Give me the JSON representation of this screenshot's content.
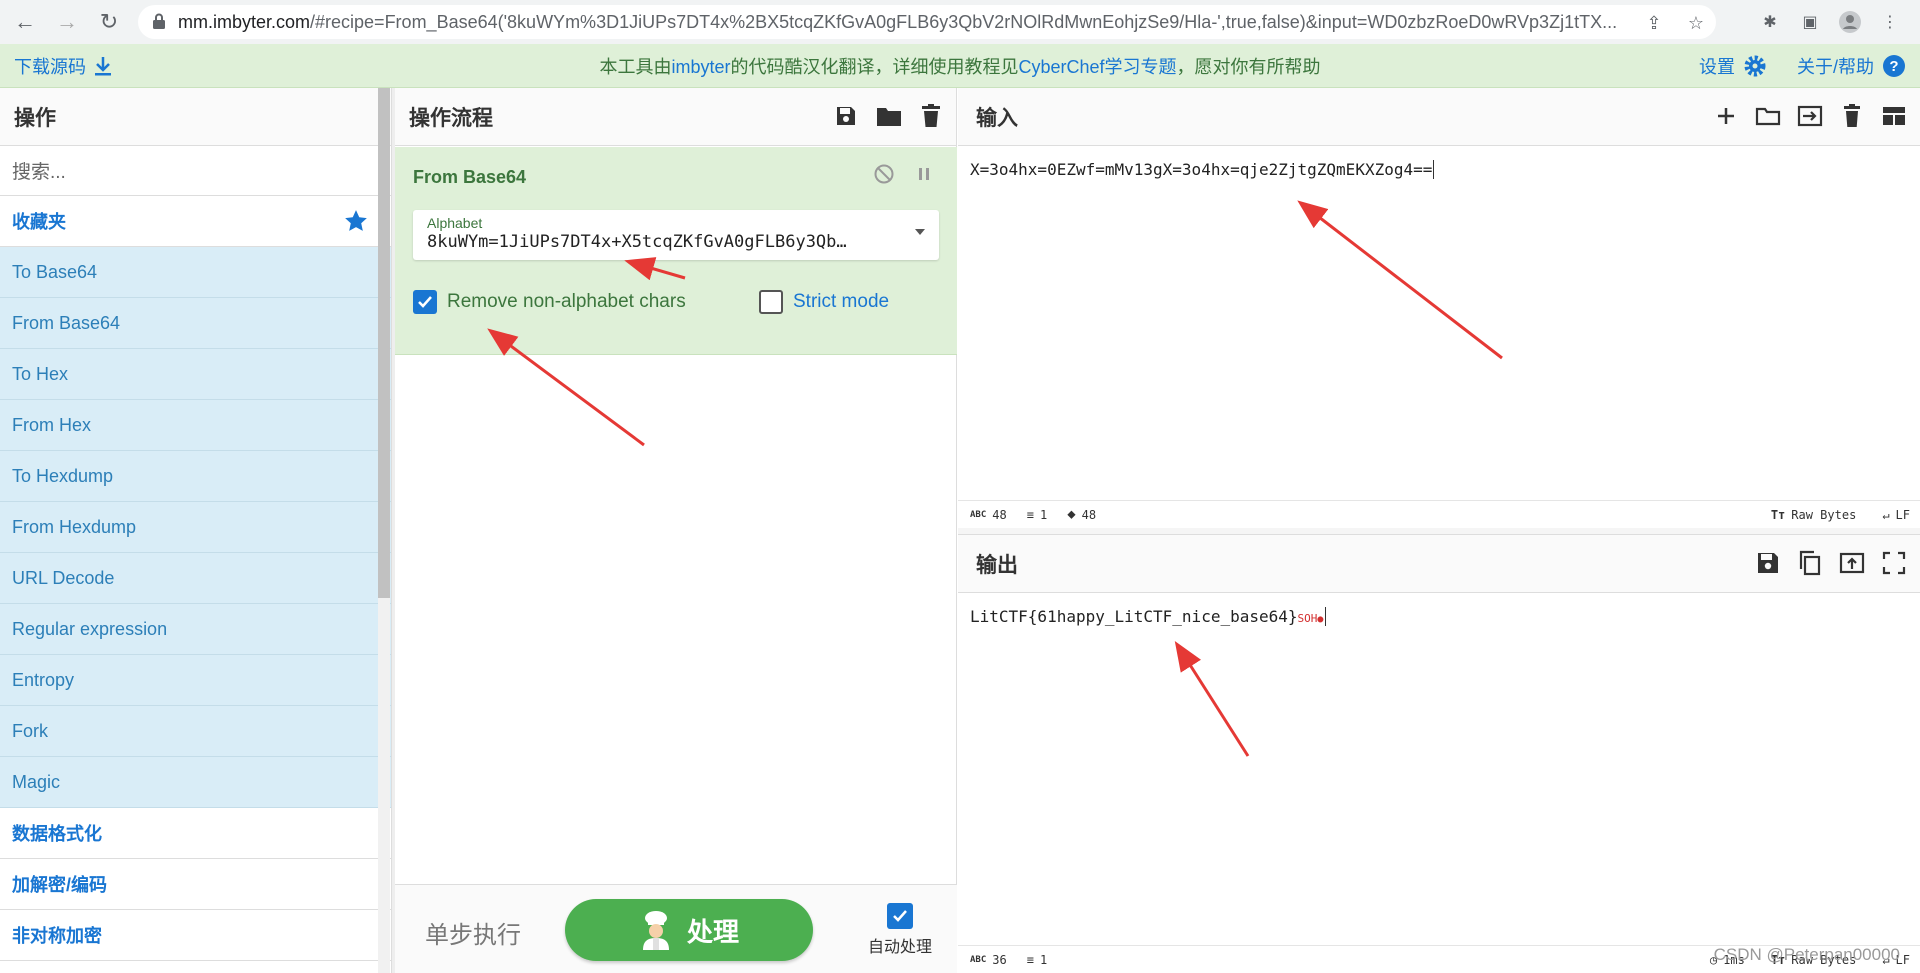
{
  "browser": {
    "url_host": "mm.imbyter.com",
    "url_rest": "/#recipe=From_Base64('8kuWYm%3D1JiUPs7DT4x%2BX5tcqZKfGvA0gFLB6y3QbV2rNOlRdMwnEohjzSe9/Hla-',true,false)&input=WD0zbzRoeD0wRVp3Zj1tTX..."
  },
  "banner": {
    "download_label": "下载源码",
    "text_before": "本工具由",
    "text_link1": "imbyter",
    "text_mid": "的代码酷汉化翻译，详细使用教程见",
    "text_link2": "CyberChef学习专题",
    "text_after": "，愿对你有所帮助",
    "settings_label": "设置",
    "about_label": "关于/帮助"
  },
  "operations": {
    "title": "操作",
    "search_placeholder": "搜索...",
    "favourites_label": "收藏夹",
    "items": [
      "To Base64",
      "From Base64",
      "To Hex",
      "From Hex",
      "To Hexdump",
      "From Hexdump",
      "URL Decode",
      "Regular expression",
      "Entropy",
      "Fork",
      "Magic"
    ],
    "categories": [
      "数据格式化",
      "加解密/编码",
      "非对称加密"
    ]
  },
  "recipe": {
    "title": "操作流程",
    "operation_name": "From Base64",
    "alphabet_label": "Alphabet",
    "alphabet_value": "8kuWYm=1JiUPs7DT4x+X5tcqZKfGvA0gFLB6y3Qb…",
    "remove_label": "Remove non-alphabet chars",
    "remove_checked": true,
    "strict_label": "Strict mode",
    "strict_checked": false,
    "step_label": "单步执行",
    "bake_label": "处理",
    "auto_bake_label": "自动处理"
  },
  "input": {
    "title": "输入",
    "text": "X=3o4hx=0EZwf=mMv13gX=3o4hx=qje2ZjtgZQmEKXZog4==",
    "status_length": "48",
    "status_lines": "1",
    "status_pos": "48",
    "encoding": "Raw Bytes",
    "eol": "LF"
  },
  "output": {
    "title": "输出",
    "text": "LitCTF{61happy_LitCTF_nice_base64}",
    "control_char": "SOH",
    "status_length": "36",
    "status_lines": "1",
    "status_time": "1ms",
    "encoding": "Raw Bytes",
    "eol": "LF"
  },
  "watermark": "CSDN @Peterpan00000",
  "colors": {
    "accent": "#1976d2",
    "op_bg": "#dff0d8",
    "bake": "#4caf50",
    "arrow": "#e53935"
  }
}
